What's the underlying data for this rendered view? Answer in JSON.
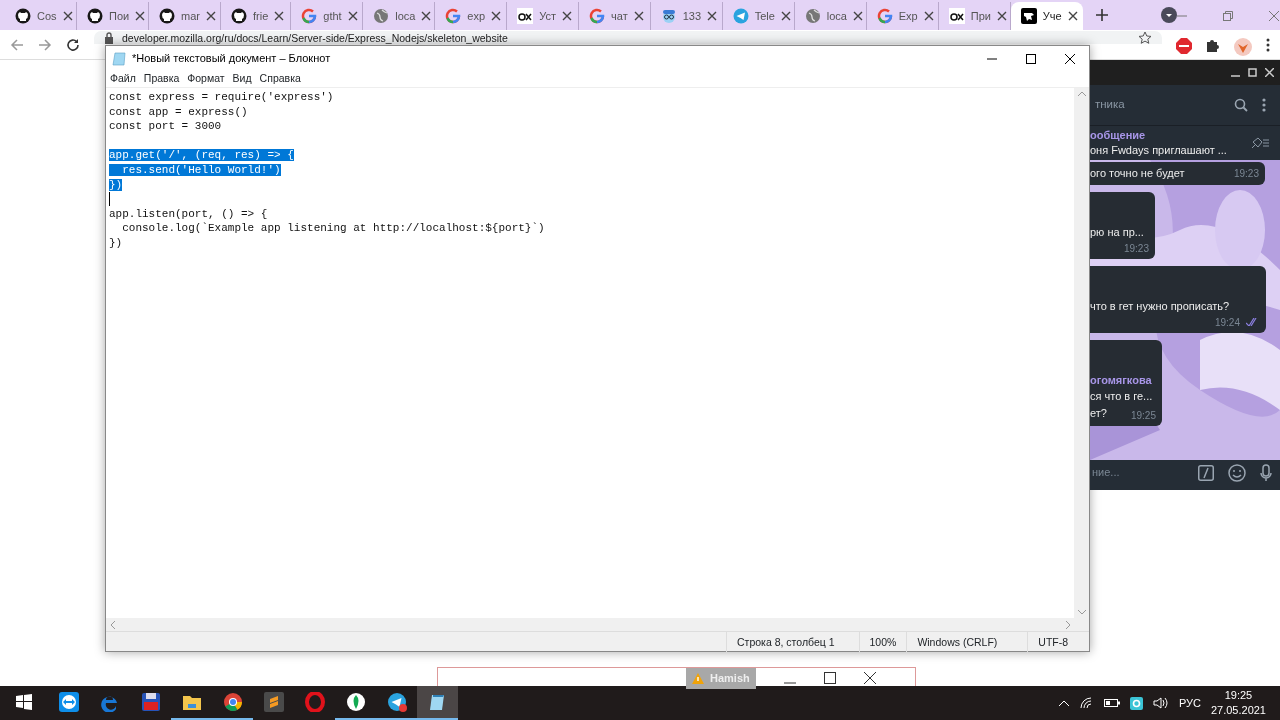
{
  "browser": {
    "tabs": [
      {
        "label": "Cos",
        "kind": "github",
        "selected": false
      },
      {
        "label": "Пои",
        "kind": "github",
        "selected": false
      },
      {
        "label": "mar",
        "kind": "github",
        "selected": false
      },
      {
        "label": "frie",
        "kind": "github",
        "selected": false
      },
      {
        "label": "gtht",
        "kind": "google",
        "selected": false
      },
      {
        "label": "loca",
        "kind": "globe",
        "selected": false
      },
      {
        "label": "exp",
        "kind": "google",
        "selected": false
      },
      {
        "label": "Уст",
        "kind": "ex",
        "selected": false
      },
      {
        "label": "чат",
        "kind": "google",
        "selected": false
      },
      {
        "label": "133",
        "kind": "face",
        "selected": false
      },
      {
        "label": "Tele",
        "kind": "telegram",
        "selected": false
      },
      {
        "label": "loca",
        "kind": "globe",
        "selected": false
      },
      {
        "label": "Exp",
        "kind": "google",
        "selected": false
      },
      {
        "label": "При",
        "kind": "ex",
        "selected": false
      },
      {
        "label": "Уче",
        "kind": "mdn",
        "selected": true
      }
    ],
    "url": "developer.mozilla.org/ru/docs/Learn/Server-side/Express_Nodejs/skeleton_website"
  },
  "notepad": {
    "title": "*Новый текстовый документ – Блокнот",
    "menu": [
      "Файл",
      "Правка",
      "Формат",
      "Вид",
      "Справка"
    ],
    "lines": [
      {
        "kind": "code",
        "text": "const express = require('express')",
        "selected": false
      },
      {
        "kind": "code",
        "text": "const app = express()",
        "selected": false
      },
      {
        "kind": "code",
        "text": "const port = 3000",
        "selected": false
      },
      {
        "kind": "blank",
        "selected": false
      },
      {
        "kind": "code",
        "text": "app.get('/', (req, res) => {",
        "selected": true
      },
      {
        "kind": "code",
        "text": "  res.send('Hello World!')",
        "selected": true
      },
      {
        "kind": "code",
        "text": "})",
        "selected": true
      },
      {
        "kind": "caret",
        "selected": false
      },
      {
        "kind": "code",
        "text": "app.listen(port, () => {",
        "selected": false
      },
      {
        "kind": "code",
        "text": "  console.log(`Example app listening at http://localhost:${port}`)",
        "selected": false
      },
      {
        "kind": "code",
        "text": "})",
        "selected": false
      }
    ],
    "status": [
      "Строка 8, столбец 1",
      "100%",
      "Windows (CRLF)",
      "UTF-8"
    ]
  },
  "telegram": {
    "search_hint": "тника",
    "pinned": {
      "title": "ообщение",
      "text": "оня Fwdays приглашают ..."
    },
    "messages": [
      {
        "kind": "incoming",
        "lines": [
          "ого точно не будет"
        ],
        "time": "19:23"
      },
      {
        "kind": "incoming",
        "lines": [
          "рю на пр..."
        ],
        "time": "19:23"
      },
      {
        "kind": "outgoing",
        "lines": [
          "что в гет нужно прописать?"
        ],
        "time": "19:24"
      },
      {
        "kind": "incoming",
        "sender": "огомягкова",
        "lines": [
          "ся что в ге...",
          "ет?"
        ],
        "time": "19:25"
      }
    ],
    "input_placeholder": "ние..."
  },
  "alert_window": {
    "label": "Hamish"
  },
  "taskbar": {
    "apps": [
      {
        "kind": "teamviewer",
        "running": false,
        "active": false
      },
      {
        "kind": "edge",
        "running": false,
        "active": false
      },
      {
        "kind": "floppy",
        "running": false,
        "active": false
      },
      {
        "kind": "folder",
        "running": true,
        "active": false
      },
      {
        "kind": "chrome",
        "running": true,
        "active": false
      },
      {
        "kind": "sublime",
        "running": false,
        "active": false
      },
      {
        "kind": "opera",
        "running": false,
        "active": false
      },
      {
        "kind": "leaf",
        "running": true,
        "active": false
      },
      {
        "kind": "telegram",
        "running": true,
        "active": false
      },
      {
        "kind": "notepad",
        "running": true,
        "active": true
      }
    ],
    "language": "РУС",
    "time": "19:25",
    "date": "27.05.2021"
  }
}
